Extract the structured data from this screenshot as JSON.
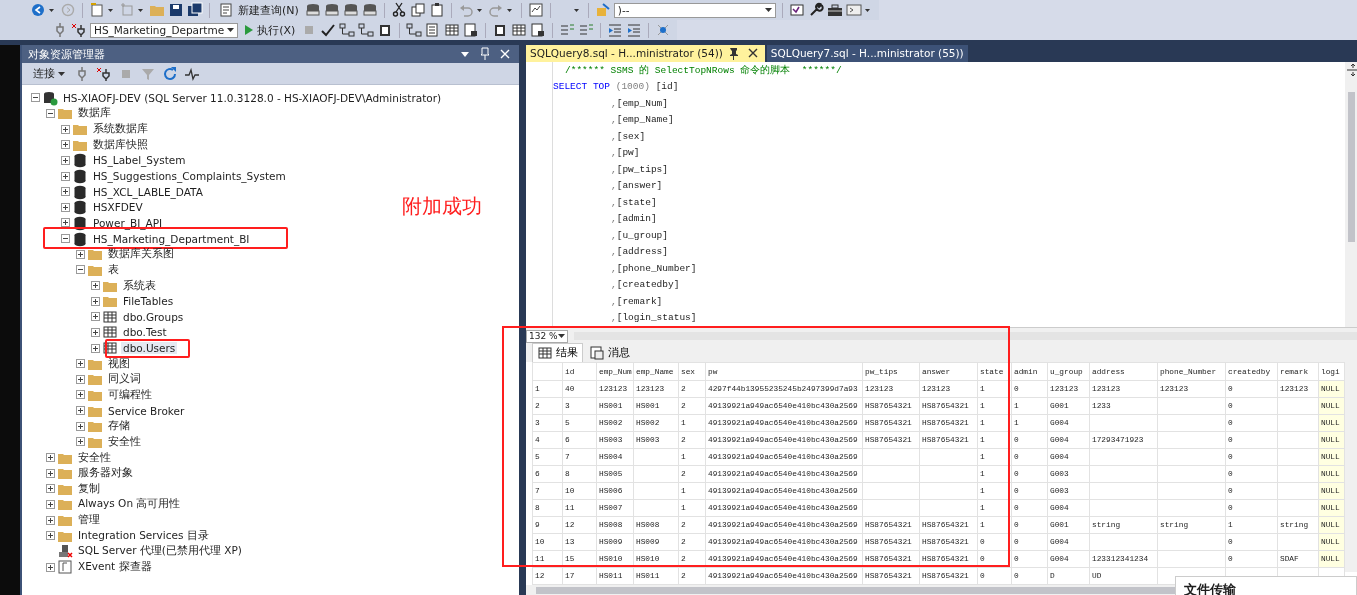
{
  "toolbar": {
    "new_query": "新建查询(N)",
    "search_combo": ")--",
    "database": "HS_Marketing_Departme",
    "execute": "执行(X)"
  },
  "explorer": {
    "title": "对象资源管理器",
    "connect": "连接",
    "annotation_note": "附加成功",
    "tree": [
      {
        "kind": "server",
        "label": "HS-XIAOFJ-DEV (SQL Server 11.0.3128.0 - HS-XIAOFJ-DEV\\Administrator)",
        "expanded": true,
        "selected": false,
        "children": [
          {
            "kind": "folder",
            "label": "数据库",
            "expanded": true,
            "selected": false,
            "children": [
              {
                "kind": "folder",
                "label": "系统数据库",
                "expanded": false,
                "selected": false
              },
              {
                "kind": "folder",
                "label": "数据库快照",
                "expanded": false,
                "selected": false
              },
              {
                "kind": "database",
                "label": "HS_Label_System",
                "expanded": false,
                "selected": false
              },
              {
                "kind": "database",
                "label": "HS_Suggestions_Complaints_System",
                "expanded": false,
                "selected": false
              },
              {
                "kind": "database",
                "label": "HS_XCL_LABLE_DATA",
                "expanded": false,
                "selected": false
              },
              {
                "kind": "database",
                "label": "HSXFDEV",
                "expanded": false,
                "selected": false
              },
              {
                "kind": "database",
                "label": "Power_BI_API",
                "expanded": false,
                "selected": false
              },
              {
                "kind": "database",
                "label": "HS_Marketing_Department_BI",
                "expanded": true,
                "selected": false,
                "annotated": true,
                "children": [
                  {
                    "kind": "folder",
                    "label": "数据库关系图",
                    "expanded": false,
                    "selected": false
                  },
                  {
                    "kind": "folder",
                    "label": "表",
                    "expanded": true,
                    "selected": false,
                    "children": [
                      {
                        "kind": "folder",
                        "label": "系统表",
                        "expanded": false,
                        "selected": false
                      },
                      {
                        "kind": "folder",
                        "label": "FileTables",
                        "expanded": false,
                        "selected": false
                      },
                      {
                        "kind": "table",
                        "label": "dbo.Groups",
                        "expanded": false,
                        "selected": false
                      },
                      {
                        "kind": "table",
                        "label": "dbo.Test",
                        "expanded": false,
                        "selected": false
                      },
                      {
                        "kind": "table",
                        "label": "dbo.Users",
                        "expanded": false,
                        "selected": true,
                        "annotated": true
                      }
                    ]
                  },
                  {
                    "kind": "folder",
                    "label": "视图",
                    "expanded": false,
                    "selected": false
                  },
                  {
                    "kind": "folder",
                    "label": "同义词",
                    "expanded": false,
                    "selected": false
                  },
                  {
                    "kind": "folder",
                    "label": "可编程性",
                    "expanded": false,
                    "selected": false
                  },
                  {
                    "kind": "folder",
                    "label": "Service Broker",
                    "expanded": false,
                    "selected": false
                  },
                  {
                    "kind": "folder",
                    "label": "存储",
                    "expanded": false,
                    "selected": false
                  },
                  {
                    "kind": "folder",
                    "label": "安全性",
                    "expanded": false,
                    "selected": false
                  }
                ]
              }
            ]
          },
          {
            "kind": "folder",
            "label": "安全性",
            "expanded": false,
            "selected": false
          },
          {
            "kind": "folder",
            "label": "服务器对象",
            "expanded": false,
            "selected": false
          },
          {
            "kind": "folder",
            "label": "复制",
            "expanded": false,
            "selected": false
          },
          {
            "kind": "folder",
            "label": "Always On 高可用性",
            "expanded": false,
            "selected": false
          },
          {
            "kind": "folder",
            "label": "管理",
            "expanded": false,
            "selected": false
          },
          {
            "kind": "folder",
            "label": "Integration Services 目录",
            "expanded": false,
            "selected": false
          },
          {
            "kind": "agent",
            "label": "SQL Server 代理(已禁用代理 XP)",
            "selected": false
          },
          {
            "kind": "xevent",
            "label": "XEvent 探查器",
            "expanded": false,
            "selected": false
          }
        ]
      }
    ]
  },
  "editor_tabs": [
    {
      "label": "SQLQuery8.sql - H...ministrator (54))",
      "selected": true
    },
    {
      "label": "SQLQuery7.sql - H...ministrator (55))",
      "selected": false
    }
  ],
  "editor_lines": [
    {
      "kind": "comment",
      "text": "/****** SSMS 的 SelectTopNRows 命令的脚本  ******/"
    },
    {
      "kind": "select",
      "keyword": "SELECT TOP",
      "paren": "(1000)",
      "name": "[id]"
    },
    {
      "kind": "column",
      "comma": ",",
      "name": "[emp_Num]"
    },
    {
      "kind": "column",
      "comma": ",",
      "name": "[emp_Name]"
    },
    {
      "kind": "column",
      "comma": ",",
      "name": "[sex]"
    },
    {
      "kind": "column",
      "comma": ",",
      "name": "[pw]"
    },
    {
      "kind": "column",
      "comma": ",",
      "name": "[pw_tips]"
    },
    {
      "kind": "column",
      "comma": ",",
      "name": "[answer]"
    },
    {
      "kind": "column",
      "comma": ",",
      "name": "[state]"
    },
    {
      "kind": "column",
      "comma": ",",
      "name": "[admin]"
    },
    {
      "kind": "column",
      "comma": ",",
      "name": "[u_group]"
    },
    {
      "kind": "column",
      "comma": ",",
      "name": "[address]"
    },
    {
      "kind": "column",
      "comma": ",",
      "name": "[phone_Number]"
    },
    {
      "kind": "column",
      "comma": ",",
      "name": "[createdby]"
    },
    {
      "kind": "column",
      "comma": ",",
      "name": "[remark]"
    },
    {
      "kind": "column",
      "comma": ",",
      "name": "[login_status]"
    }
  ],
  "zoom": "132 %",
  "result_tabs": [
    {
      "kind": "grid",
      "label": "结果",
      "selected": true
    },
    {
      "kind": "messages",
      "label": "消息",
      "selected": false
    }
  ],
  "results": {
    "annotated": true,
    "columns": [
      "id",
      "emp_Num",
      "emp_Name",
      "sex",
      "pw",
      "pw_tips",
      "answer",
      "state",
      "admin",
      "u_group",
      "address",
      "phone_Number",
      "createdby",
      "remark",
      "logi"
    ],
    "rows": [
      {
        "number": "1",
        "cells": [
          "40",
          "123123",
          "123123",
          "2",
          "4297f44b13955235245b2497399d7a93",
          "123123",
          "123123",
          "1",
          "0",
          "123123",
          "123123",
          "123123",
          "0",
          "123123",
          "NULL"
        ]
      },
      {
        "number": "2",
        "cells": [
          "3",
          "HS001",
          "HS001",
          "2",
          "49139921a949ac6540e410bc430a2569",
          "HS87654321",
          "HS87654321",
          "1",
          "1",
          "G001",
          "1233",
          null,
          "0",
          null,
          "NULL"
        ]
      },
      {
        "number": "3",
        "cells": [
          "5",
          "HS002",
          "HS002",
          "1",
          "49139921a949ac6540e410bc430a2569",
          "HS87654321",
          "HS87654321",
          "1",
          "1",
          "G004",
          null,
          null,
          "0",
          null,
          "NULL"
        ]
      },
      {
        "number": "4",
        "cells": [
          "6",
          "HS003",
          "HS003",
          "2",
          "49139921a949ac6540e410bc430a2569",
          "HS87654321",
          "HS87654321",
          "1",
          "0",
          "G004",
          "17293471923",
          null,
          "0",
          null,
          "NULL"
        ]
      },
      {
        "number": "5",
        "cells": [
          "7",
          "HS004",
          null,
          "1",
          "49139921a949ac6540e410bc430a2569",
          null,
          null,
          "1",
          "0",
          "G004",
          null,
          null,
          "0",
          null,
          "NULL"
        ]
      },
      {
        "number": "6",
        "cells": [
          "8",
          "HS005",
          null,
          "2",
          "49139921a949ac6540e410bc430a2569",
          null,
          null,
          "1",
          "0",
          "G003",
          null,
          null,
          "0",
          null,
          "NULL"
        ]
      },
      {
        "number": "7",
        "cells": [
          "10",
          "HS006",
          null,
          "1",
          "49139921a949ac6540e410bc430a2569",
          null,
          null,
          "1",
          "0",
          "G003",
          null,
          null,
          "0",
          null,
          "NULL"
        ]
      },
      {
        "number": "8",
        "cells": [
          "11",
          "HS007",
          null,
          "1",
          "49139921a949ac6540e410bc430a2569",
          null,
          null,
          "1",
          "0",
          "G004",
          null,
          null,
          "0",
          null,
          "NULL"
        ]
      },
      {
        "number": "9",
        "cells": [
          "12",
          "HS008",
          "HS008",
          "2",
          "49139921a949ac6540e410bc430a2569",
          "HS87654321",
          "HS87654321",
          "1",
          "0",
          "G001",
          "string",
          "string",
          "1",
          "string",
          "NULL"
        ]
      },
      {
        "number": "10",
        "cells": [
          "13",
          "HS009",
          "HS009",
          "2",
          "49139921a949ac6540e410bc430a2569",
          "HS87654321",
          "HS87654321",
          "0",
          "0",
          "G004",
          null,
          null,
          "0",
          null,
          "NULL"
        ]
      },
      {
        "number": "11",
        "cells": [
          "15",
          "HS010",
          "HS010",
          "2",
          "49139921a949ac6540e410bc430a2569",
          "HS87654321",
          "HS87654321",
          "0",
          "0",
          "G004",
          "123312341234",
          null,
          "0",
          "SDAF",
          "NULL"
        ]
      },
      {
        "number": "12",
        "cells": [
          "17",
          "HS011",
          "HS011",
          "2",
          "49139921a949ac6540e410bc430a2569",
          "HS87654321",
          "HS87654321",
          "0",
          "0",
          "D",
          "UD",
          null,
          null,
          null,
          null
        ]
      }
    ]
  },
  "overlay_window": {
    "title": "文件传输"
  }
}
